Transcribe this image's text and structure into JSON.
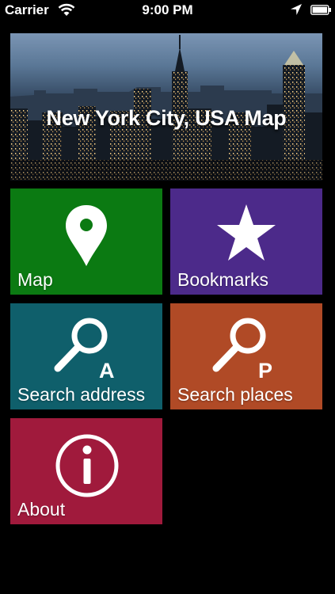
{
  "status_bar": {
    "carrier": "Carrier",
    "time": "9:00 PM"
  },
  "banner": {
    "title": "New York City, USA Map"
  },
  "tiles": [
    {
      "label": "Map",
      "icon": "map-pin-icon",
      "color": "#0b7a12"
    },
    {
      "label": "Bookmarks",
      "icon": "star-icon",
      "color": "#4c2a8a"
    },
    {
      "label": "Search address",
      "icon": "search-address-icon",
      "icon_letter": "A",
      "color": "#0f5f6b"
    },
    {
      "label": "Search places",
      "icon": "search-places-icon",
      "icon_letter": "P",
      "color": "#b04a26"
    },
    {
      "label": "About",
      "icon": "info-icon",
      "color": "#a01a3c"
    }
  ]
}
